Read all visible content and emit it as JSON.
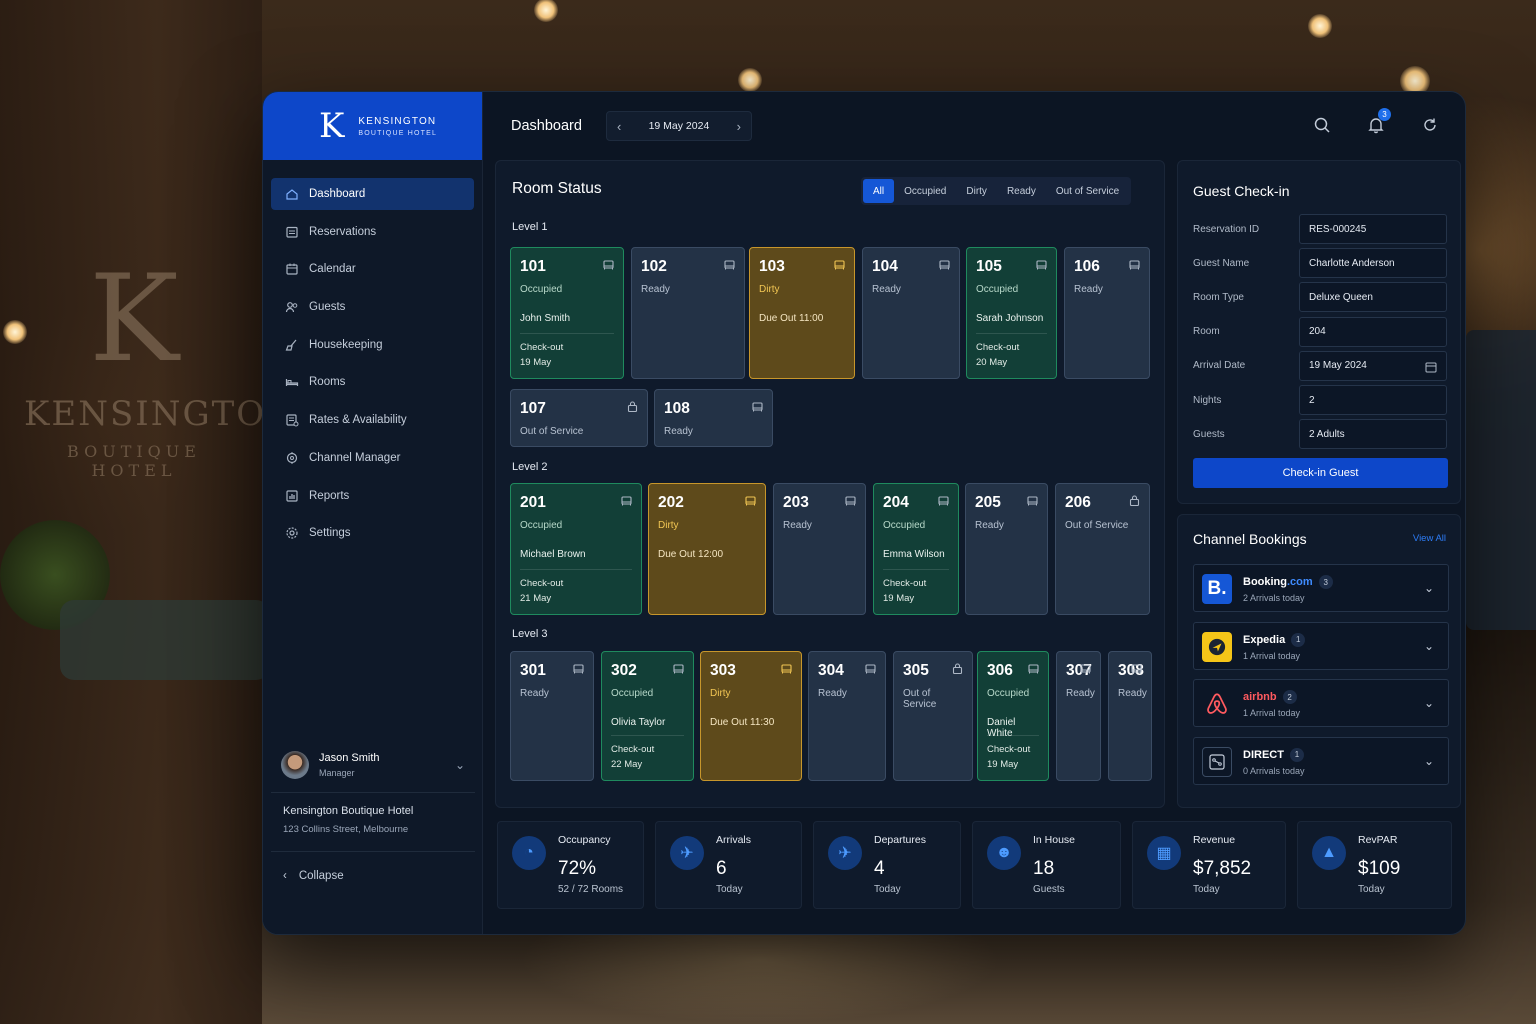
{
  "brand": {
    "mark": "K",
    "name": "KENSINGTON",
    "sub": "BOUTIQUE HOTEL"
  },
  "background_sign": {
    "mark": "K",
    "name": "KENSINGTON",
    "sub": "BOUTIQUE HOTEL"
  },
  "nav": [
    {
      "label": "Dashboard",
      "icon": "home-icon",
      "active": true
    },
    {
      "label": "Reservations",
      "icon": "reservations-icon"
    },
    {
      "label": "Calendar",
      "icon": "calendar-icon"
    },
    {
      "label": "Guests",
      "icon": "guests-icon"
    },
    {
      "label": "Housekeeping",
      "icon": "broom-icon"
    },
    {
      "label": "Rooms",
      "icon": "bed-icon"
    },
    {
      "label": "Rates & Availability",
      "icon": "rates-icon"
    },
    {
      "label": "Channel Manager",
      "icon": "channel-icon"
    },
    {
      "label": "Reports",
      "icon": "reports-icon"
    },
    {
      "label": "Settings",
      "icon": "gear-icon"
    }
  ],
  "user": {
    "name": "Jason Smith",
    "role": "Manager"
  },
  "hotel": {
    "name": "Kensington Boutique Hotel",
    "address": "123 Collins Street, Melbourne"
  },
  "collapse_label": "Collapse",
  "topbar": {
    "title": "Dashboard",
    "date": "19 May 2024",
    "notifications": "3"
  },
  "room_status": {
    "title": "Room Status",
    "filters": [
      "All",
      "Occupied",
      "Dirty",
      "Ready",
      "Out of Service"
    ],
    "active_filter": "All",
    "levels": [
      {
        "label": "Level 1",
        "rooms": [
          {
            "num": "101",
            "status": "Occupied",
            "guest": "John Smith",
            "checkout_label": "Check-out",
            "checkout_date": "19 May"
          },
          {
            "num": "102",
            "status": "Ready"
          },
          {
            "num": "103",
            "status": "Dirty",
            "due": "Due Out 11:00"
          },
          {
            "num": "104",
            "status": "Ready"
          },
          {
            "num": "105",
            "status": "Occupied",
            "guest": "Sarah Johnson",
            "checkout_label": "Check-out",
            "checkout_date": "20 May"
          },
          {
            "num": "106",
            "status": "Ready"
          },
          {
            "num": "107",
            "status": "Out of Service"
          },
          {
            "num": "108",
            "status": "Ready"
          }
        ]
      },
      {
        "label": "Level 2",
        "rooms": [
          {
            "num": "201",
            "status": "Occupied",
            "guest": "Michael Brown",
            "checkout_label": "Check-out",
            "checkout_date": "21 May"
          },
          {
            "num": "202",
            "status": "Dirty",
            "due": "Due Out 12:00"
          },
          {
            "num": "203",
            "status": "Ready"
          },
          {
            "num": "204",
            "status": "Occupied",
            "guest": "Emma Wilson",
            "checkout_label": "Check-out",
            "checkout_date": "19 May"
          },
          {
            "num": "205",
            "status": "Ready"
          },
          {
            "num": "206",
            "status": "Out of Service"
          }
        ]
      },
      {
        "label": "Level 3",
        "rooms": [
          {
            "num": "301",
            "status": "Ready"
          },
          {
            "num": "302",
            "status": "Occupied",
            "guest": "Olivia Taylor",
            "checkout_label": "Check-out",
            "checkout_date": "22 May"
          },
          {
            "num": "303",
            "status": "Dirty",
            "due": "Due Out 11:30"
          },
          {
            "num": "304",
            "status": "Ready"
          },
          {
            "num": "305",
            "status": "Out of Service"
          },
          {
            "num": "306",
            "status": "Occupied",
            "guest": "Daniel White",
            "checkout_label": "Check-out",
            "checkout_date": "19 May"
          },
          {
            "num": "307",
            "status": "Ready"
          },
          {
            "num": "308",
            "status": "Ready"
          }
        ]
      }
    ]
  },
  "checkin": {
    "title": "Guest Check-in",
    "fields": [
      {
        "label": "Reservation ID",
        "value": "RES-000245"
      },
      {
        "label": "Guest Name",
        "value": "Charlotte Anderson"
      },
      {
        "label": "Room Type",
        "value": "Deluxe Queen"
      },
      {
        "label": "Room",
        "value": "204"
      },
      {
        "label": "Arrival Date",
        "value": "19 May 2024"
      },
      {
        "label": "Nights",
        "value": "2"
      },
      {
        "label": "Guests",
        "value": "2 Adults"
      }
    ],
    "button": "Check-in Guest"
  },
  "channels": {
    "title": "Channel Bookings",
    "view_all": "View All",
    "items": [
      {
        "name": "Booking",
        "name_suffix": ".com",
        "count": "3",
        "sub": "2 Arrivals today",
        "logo_text": "B.",
        "color": "#1557d6"
      },
      {
        "name": "Expedia",
        "count": "1",
        "sub": "1 Arrival today",
        "color": "#f5c518"
      },
      {
        "name": "airbnb",
        "count": "2",
        "sub": "1 Arrival today",
        "color": "#ff5a5f"
      },
      {
        "name": "DIRECT",
        "count": "1",
        "sub": "0 Arrivals today",
        "color": "#c5cedb"
      }
    ]
  },
  "stats": [
    {
      "label": "Occupancy",
      "value": "72%",
      "sub": "52 / 72 Rooms",
      "icon": "occupancy-icon"
    },
    {
      "label": "Arrivals",
      "value": "6",
      "sub": "Today",
      "icon": "arrivals-icon"
    },
    {
      "label": "Departures",
      "value": "4",
      "sub": "Today",
      "icon": "departures-icon"
    },
    {
      "label": "In House",
      "value": "18",
      "sub": "Guests",
      "icon": "in-house-icon"
    },
    {
      "label": "Revenue",
      "value": "$7,852",
      "sub": "Today",
      "icon": "revenue-icon"
    },
    {
      "label": "RevPAR",
      "value": "$109",
      "sub": "Today",
      "icon": "revpar-icon"
    }
  ],
  "colors": {
    "accent": "#0d47c9",
    "occupied": "#1f8a5e",
    "dirty": "#c7962b",
    "ready": "#3a4b63"
  }
}
